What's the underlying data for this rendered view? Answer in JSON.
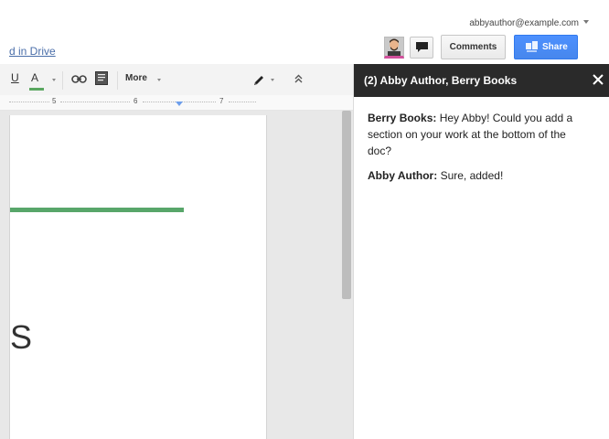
{
  "header": {
    "account_email": "abbyauthor@example.com",
    "saved_status": "d in Drive",
    "comments_label": "Comments",
    "share_label": "Share"
  },
  "toolbar": {
    "underline_label": "U",
    "text_color_label": "A",
    "more_label": "More"
  },
  "ruler": {
    "numbers": [
      "5",
      "6",
      "7"
    ]
  },
  "document": {
    "visible_text": "S"
  },
  "chat": {
    "title": "(2) Abby Author, Berry Books",
    "messages": [
      {
        "author": "Berry Books:",
        "text": "Hey Abby! Could you add a section on your work at the bottom of the doc?"
      },
      {
        "author": "Abby Author:",
        "text": "Sure, added!"
      }
    ]
  },
  "colors": {
    "share_blue": "#4d90fe",
    "chat_header": "#2a2a2a",
    "doc_rule_green": "#58a66a",
    "avatar_underline": "#d2509c"
  },
  "icons": [
    "caret-down-icon",
    "avatar-icon",
    "chat-icon",
    "drive-share-icon",
    "link-icon",
    "comment-icon",
    "pencil-icon",
    "collapse-icon",
    "close-icon"
  ]
}
